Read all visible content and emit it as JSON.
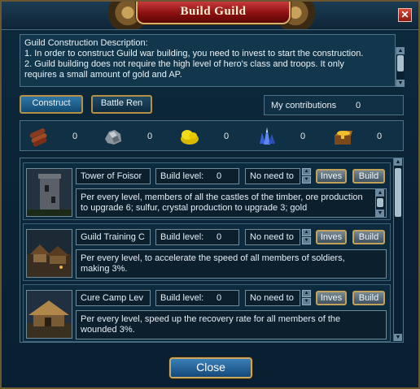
{
  "window": {
    "title": "Build Guild",
    "close_icon": "close-x-icon",
    "accent": "#b79046",
    "title_color": "#a81818"
  },
  "description": {
    "lines": [
      "Guild Construction Description:",
      "1. In order to construct Guild war building, you need to invest to start the construction.",
      "2. Guild building does not require the high level of hero's class and troops. It only",
      "requires a small amount of gold and AP."
    ]
  },
  "tabs": {
    "construct": "Construct",
    "battle": "Battle Ren"
  },
  "contributions": {
    "label": "My contributions",
    "value": "0"
  },
  "resources": [
    {
      "icon": "timber-icon",
      "value": "0"
    },
    {
      "icon": "ore-icon",
      "value": "0"
    },
    {
      "icon": "sulfur-icon",
      "value": "0"
    },
    {
      "icon": "crystal-icon",
      "value": "0"
    },
    {
      "icon": "gold-icon",
      "value": "0"
    }
  ],
  "buildings": [
    {
      "name": "Tower of Foisor",
      "level_label": "Build level:",
      "level": "0",
      "need": "No need to",
      "invest": "Inves",
      "build": "Build",
      "desc": "Per every level, members of all the castles of the timber, ore production to upgrade 6; sulfur, crystal production to upgrade 3; gold"
    },
    {
      "name": "Guild Training C",
      "level_label": "Build level:",
      "level": "0",
      "need": "No need to",
      "invest": "Inves",
      "build": "Build",
      "desc": "Per every level, to accelerate the speed of all members of soldiers, making 3%."
    },
    {
      "name": "Cure Camp Lev",
      "level_label": "Build level:",
      "level": "0",
      "need": "No need to",
      "invest": "Inves",
      "build": "Build",
      "desc": "Per every level, speed up the recovery rate for all members of the wounded 3%."
    }
  ],
  "footer": {
    "close": "Close"
  }
}
